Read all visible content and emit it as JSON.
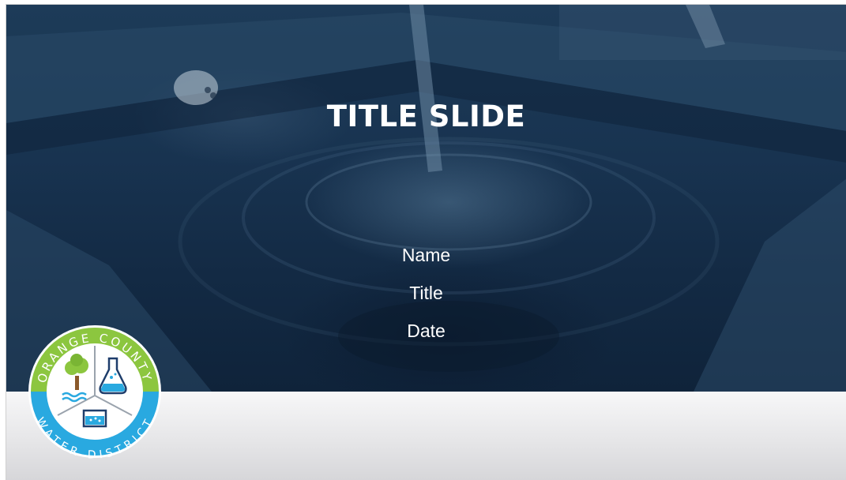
{
  "slide": {
    "title": "TITLE SLIDE",
    "name": "Name",
    "job_title": "Title",
    "date": "Date"
  },
  "logo": {
    "top_text": "ORANGE COUNTY",
    "bottom_text": "WATER DISTRICT",
    "colors": {
      "green": "#8cc63f",
      "blue": "#29a9e0",
      "navy": "#1e3d6b"
    }
  },
  "colors": {
    "overlay": "#183350",
    "footer": "#e6e6e8",
    "text": "#ffffff"
  }
}
